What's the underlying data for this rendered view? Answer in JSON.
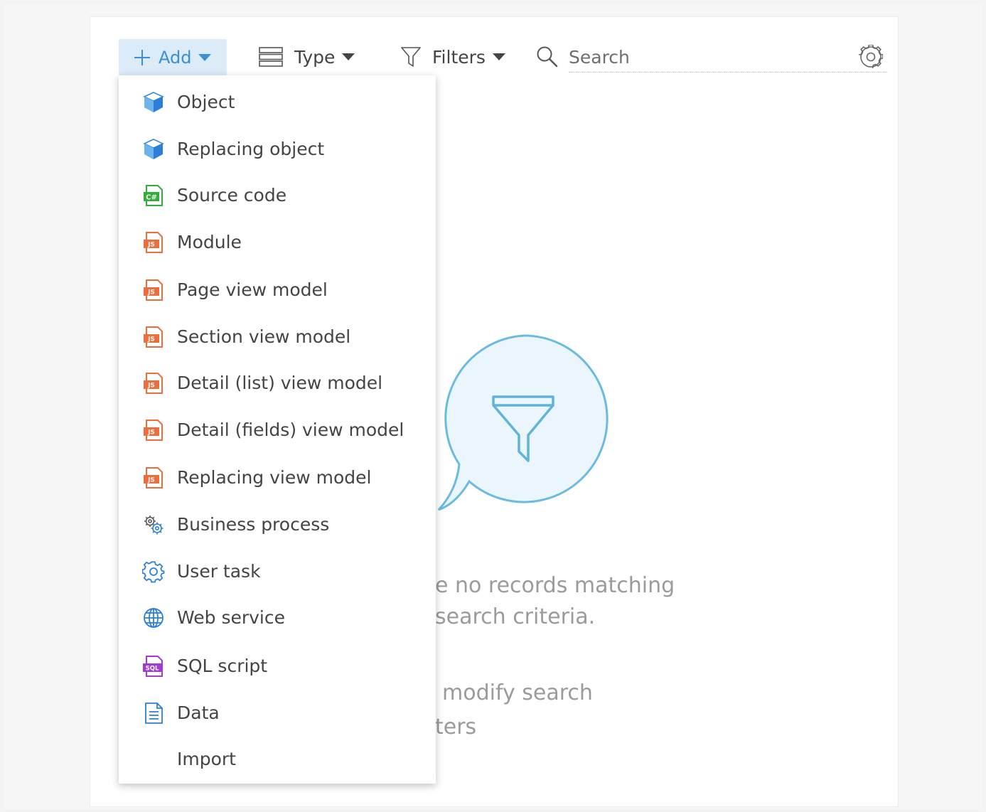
{
  "toolbar": {
    "add_label": "Add",
    "type_label": "Type",
    "filters_label": "Filters",
    "search_placeholder": "Search"
  },
  "menu": {
    "items": [
      {
        "label": "Object",
        "icon": "object-cube-icon"
      },
      {
        "label": "Replacing object",
        "icon": "object-cube-icon"
      },
      {
        "label": "Source code",
        "icon": "csharp-file-icon"
      },
      {
        "label": "Module",
        "icon": "js-file-icon"
      },
      {
        "label": "Page view model",
        "icon": "js-file-icon"
      },
      {
        "label": "Section view model",
        "icon": "js-file-icon"
      },
      {
        "label": "Detail (list) view model",
        "icon": "js-file-icon"
      },
      {
        "label": "Detail (fields) view model",
        "icon": "js-file-icon"
      },
      {
        "label": "Replacing view model",
        "icon": "js-file-icon"
      },
      {
        "label": "Business process",
        "icon": "gears-icon"
      },
      {
        "label": "User task",
        "icon": "gear-icon"
      },
      {
        "label": "Web service",
        "icon": "globe-icon"
      },
      {
        "label": "SQL script",
        "icon": "sql-file-icon"
      },
      {
        "label": "Data",
        "icon": "document-icon"
      },
      {
        "label": "Import",
        "icon": ""
      }
    ]
  },
  "empty_state": {
    "line1": "e no records matching",
    "line2": "search criteria.",
    "line3": "modify search",
    "line4": "ters"
  },
  "colors": {
    "accent": "#3a8fd9",
    "add_button_bg": "#dcebf8",
    "js_icon": "#ee6d3a",
    "cs_icon": "#2fae3a",
    "sql_icon": "#a23bd6",
    "cube_icon": "#2b7fd6",
    "illustration_stroke": "#6bbbe0",
    "illustration_fill": "#eaf6fc"
  }
}
